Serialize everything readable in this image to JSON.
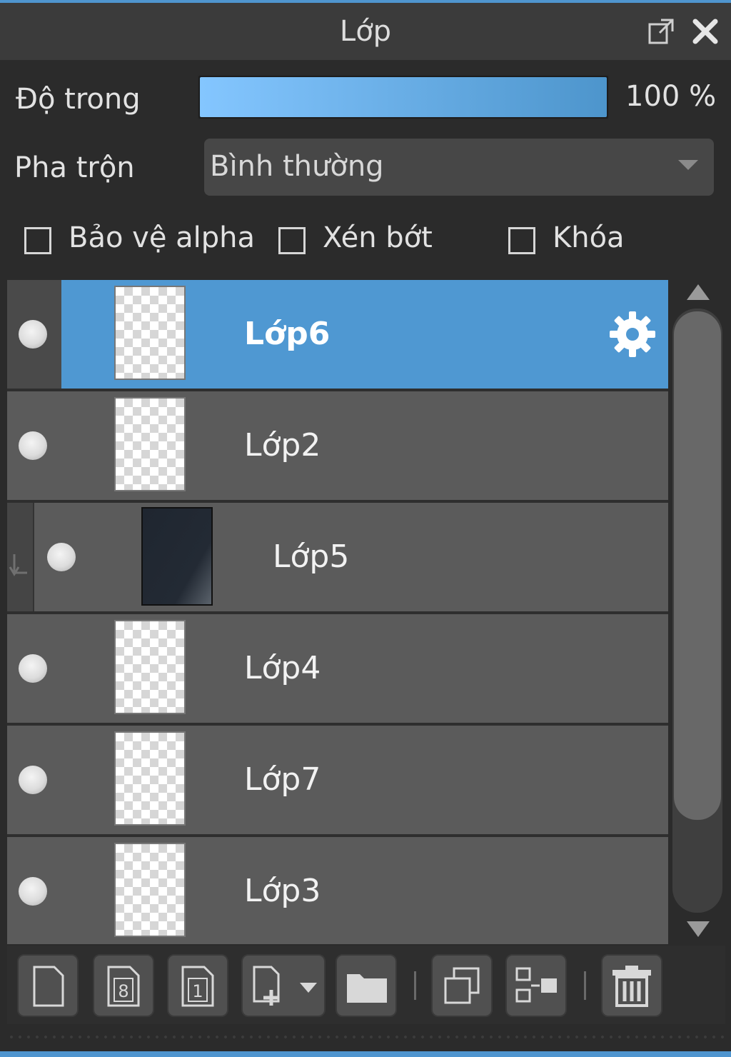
{
  "panel": {
    "title": "Lớp"
  },
  "opacity": {
    "label": "Độ trong",
    "value_text": "100 %",
    "value": 1.0
  },
  "blend": {
    "label": "Pha trộn",
    "selected": "Bình thường"
  },
  "checkboxes": [
    {
      "label": "Bảo vệ alpha",
      "checked": false
    },
    {
      "label": "Xén bớt",
      "checked": false
    },
    {
      "label": "Khóa",
      "checked": false
    }
  ],
  "layers": [
    {
      "name": "Lớp6",
      "selected": true,
      "visible": true
    },
    {
      "name": "Lớp2",
      "selected": false,
      "visible": true
    },
    {
      "name": "Lớp5",
      "selected": false,
      "visible": true,
      "clipped": true
    },
    {
      "name": "Lớp4",
      "selected": false,
      "visible": true
    },
    {
      "name": "Lớp7",
      "selected": false,
      "visible": true
    },
    {
      "name": "Lớp3",
      "selected": false,
      "visible": true
    }
  ],
  "toolbar": {
    "icons": [
      "new-layer-icon",
      "new-8bit-layer-icon",
      "new-1bit-layer-icon",
      "add-layer-menu-icon",
      "folder-icon",
      "duplicate-icon",
      "merge-down-icon",
      "delete-icon"
    ],
    "badge_8": "8",
    "badge_1": "1"
  },
  "colors": {
    "accent": "#4f98d2",
    "slider_start": "#84c6ff",
    "slider_end": "#4d95cc"
  }
}
